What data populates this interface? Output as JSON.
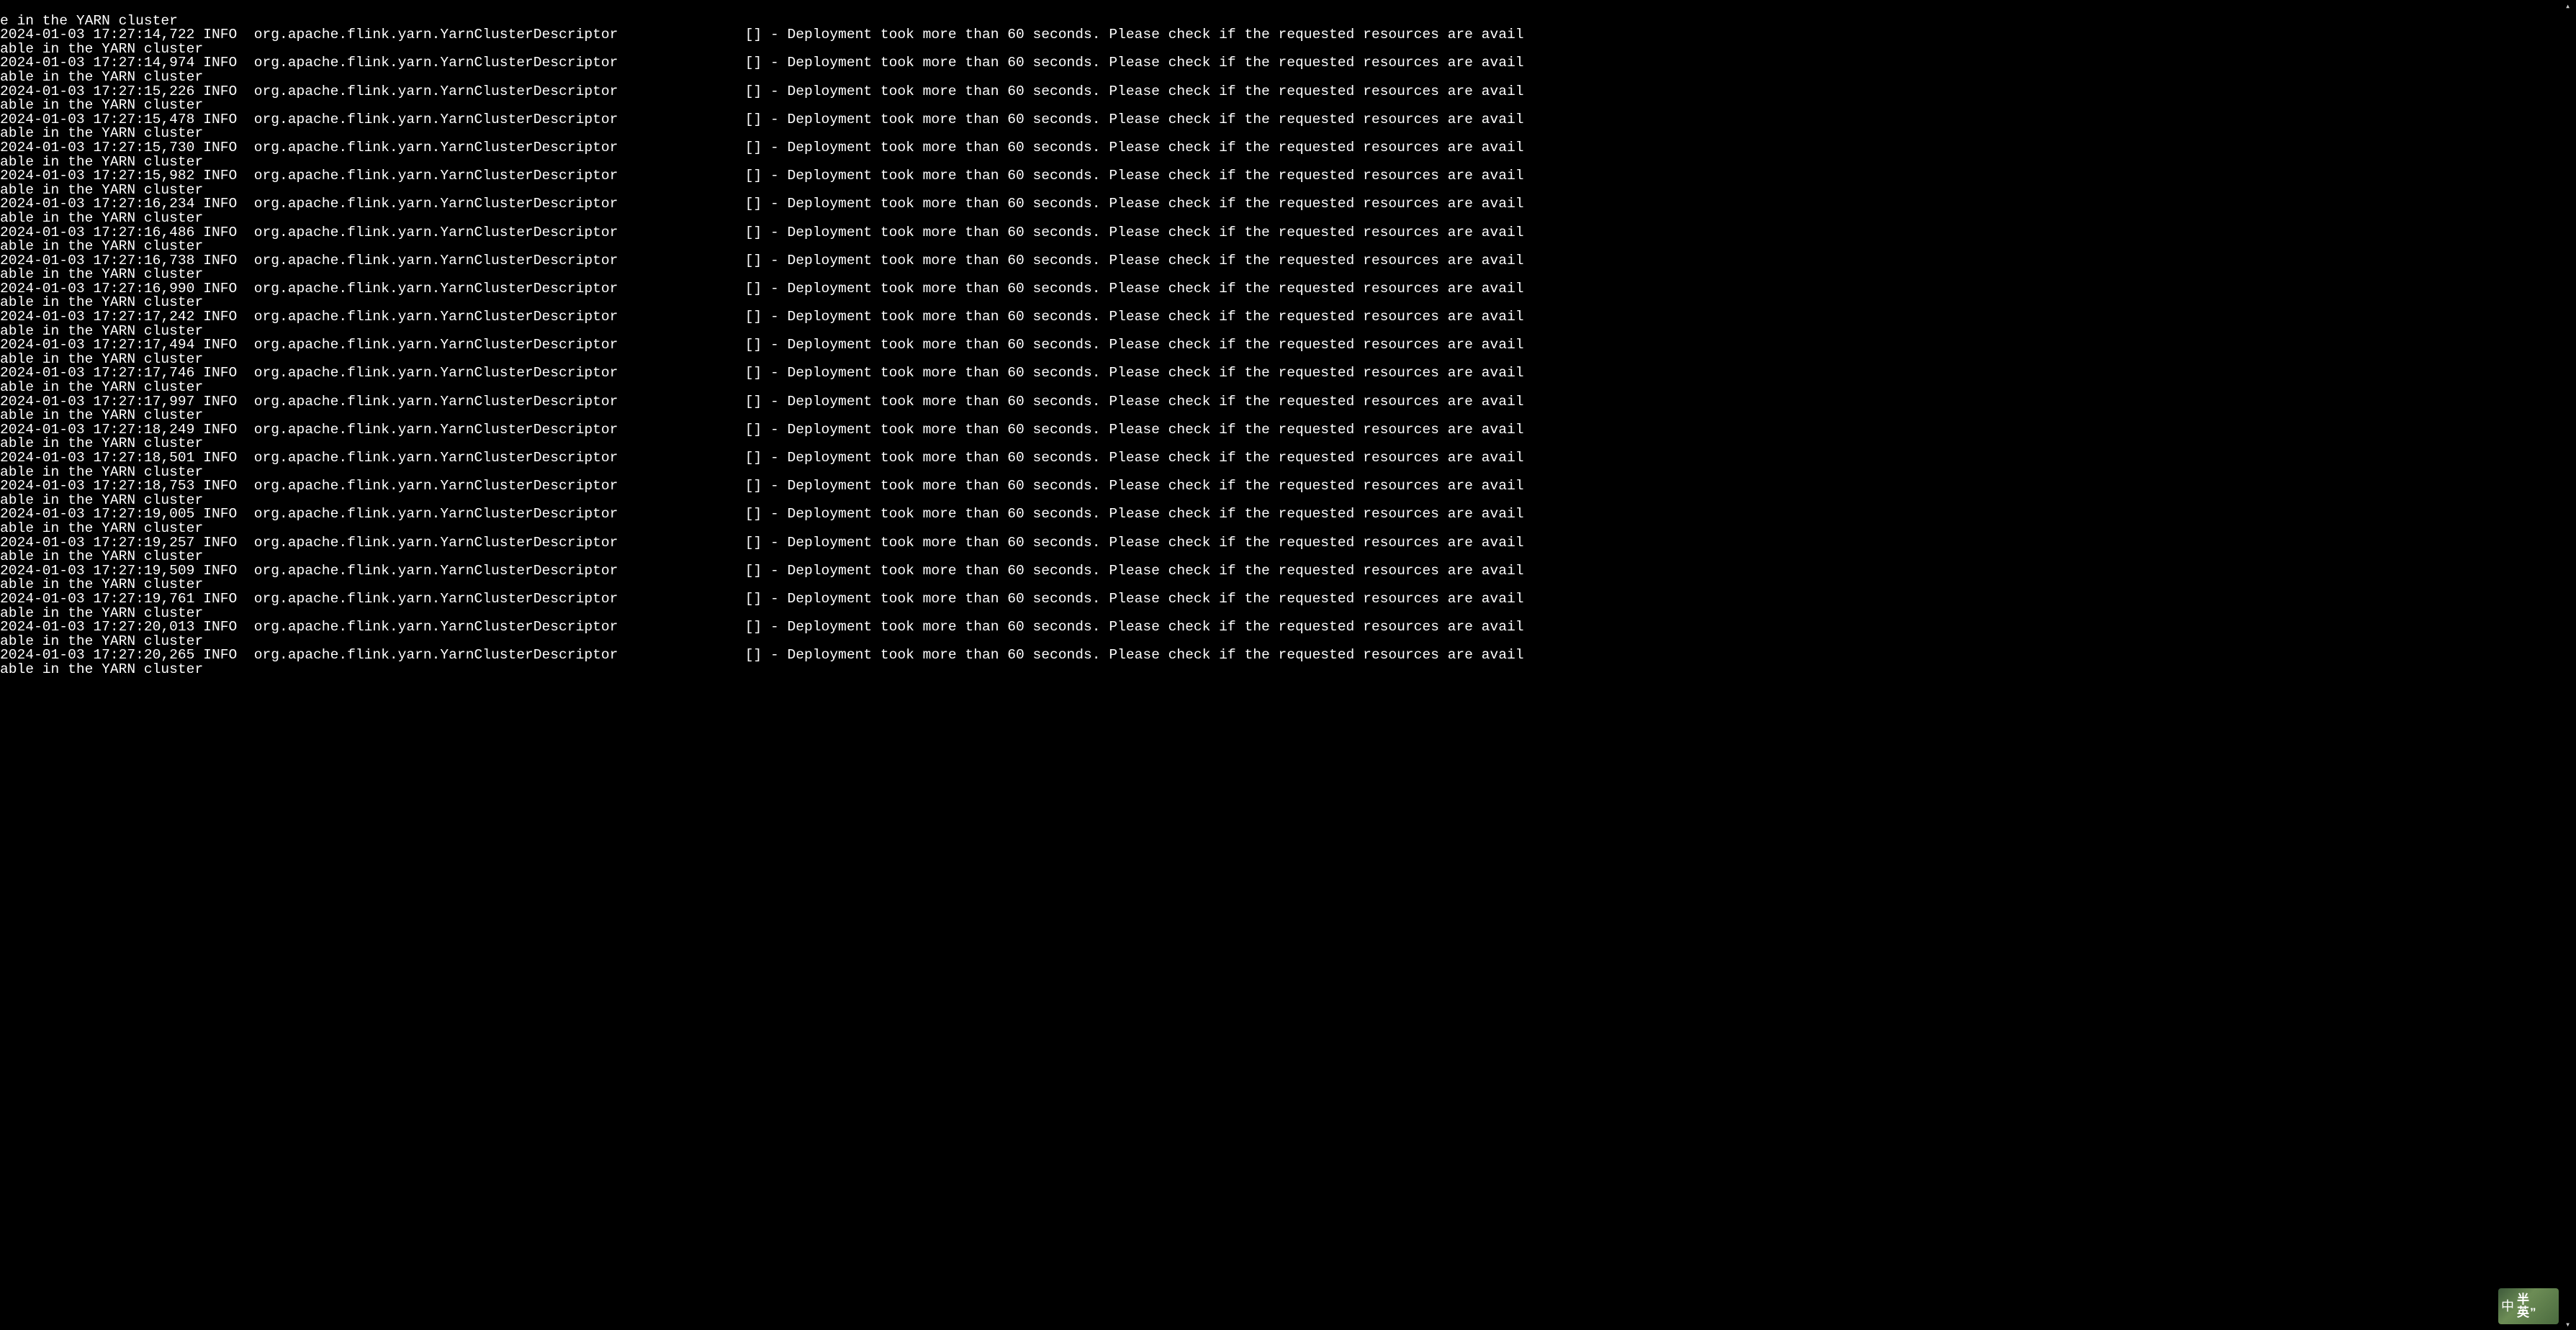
{
  "terminal": {
    "columns": 180,
    "level": "INFO",
    "logger": "org.apache.flink.yarn.YarnClusterDescriptor",
    "bracket": "[]",
    "message": "Deployment took more than 60 seconds. Please check if the requested resources are available in the YARN cluster",
    "first_line_tail": "e in the YARN cluster",
    "timestamps": [
      "2024-01-03 17:27:14,722",
      "2024-01-03 17:27:14,974",
      "2024-01-03 17:27:15,226",
      "2024-01-03 17:27:15,478",
      "2024-01-03 17:27:15,730",
      "2024-01-03 17:27:15,982",
      "2024-01-03 17:27:16,234",
      "2024-01-03 17:27:16,486",
      "2024-01-03 17:27:16,738",
      "2024-01-03 17:27:16,990",
      "2024-01-03 17:27:17,242",
      "2024-01-03 17:27:17,494",
      "2024-01-03 17:27:17,746",
      "2024-01-03 17:27:17,997",
      "2024-01-03 17:27:18,249",
      "2024-01-03 17:27:18,501",
      "2024-01-03 17:27:18,753",
      "2024-01-03 17:27:19,005",
      "2024-01-03 17:27:19,257",
      "2024-01-03 17:27:19,509",
      "2024-01-03 17:27:19,761",
      "2024-01-03 17:27:20,013",
      "2024-01-03 17:27:20,265"
    ]
  },
  "ime": {
    "left_glyph": "中",
    "line1": "半",
    "line2": "英",
    "quote": "”"
  },
  "scrollbar": {
    "up": "▴",
    "down": "▾"
  }
}
